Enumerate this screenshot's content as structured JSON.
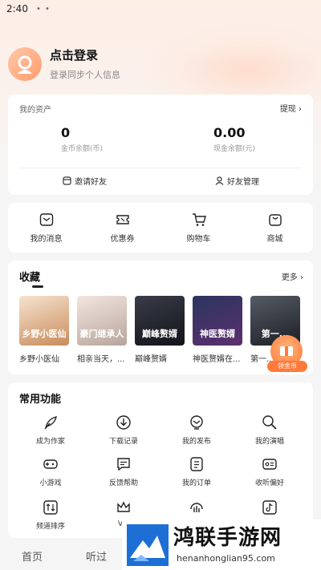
{
  "status": {
    "time": "2:40",
    "dots": "• •"
  },
  "profile": {
    "title": "点击登录",
    "subtitle": "登录同步个人信息"
  },
  "assets": {
    "header": "我的资产",
    "withdraw": "提现 ›",
    "coins_value": "0",
    "coins_label": "金币余额(币)",
    "cash_value": "0.00",
    "cash_label": "现金余额(元)",
    "invite": "邀请好友",
    "friends": "好友管理"
  },
  "quick": [
    {
      "label": "我的消息",
      "icon": "message-icon"
    },
    {
      "label": "优惠券",
      "icon": "coupon-icon"
    },
    {
      "label": "购物车",
      "icon": "cart-icon"
    },
    {
      "label": "商城",
      "icon": "shop-icon"
    }
  ],
  "favorites": {
    "title": "收藏",
    "more": "更多 ›",
    "books": [
      {
        "title": "乡野小医仙",
        "cover_text": "乡野小医仙",
        "colors": [
          "#f6e3cf",
          "#c98c5b"
        ]
      },
      {
        "title": "相亲当天，...",
        "cover_text": "豪门继承人",
        "colors": [
          "#f3e6e0",
          "#b7a59c"
        ]
      },
      {
        "title": "巅峰赘婿",
        "cover_text": "巅峰赘婿",
        "colors": [
          "#3a3d4a",
          "#111318"
        ]
      },
      {
        "title": "神医赘婿在...",
        "cover_text": "神医赘婿",
        "colors": [
          "#2c3560",
          "#5b2f6e"
        ]
      },
      {
        "title": "第一...",
        "cover_text": "第一...",
        "colors": [
          "#555b66",
          "#1c1e24"
        ]
      }
    ],
    "coin_badge": "领金币"
  },
  "tools": {
    "title": "常用功能",
    "items": [
      {
        "label": "成为作家",
        "icon": "feather-icon"
      },
      {
        "label": "下载记录",
        "icon": "download-icon"
      },
      {
        "label": "我的发布",
        "icon": "publish-icon"
      },
      {
        "label": "我的演唱",
        "icon": "sing-icon"
      },
      {
        "label": "小游戏",
        "icon": "gamepad-icon"
      },
      {
        "label": "反馈帮助",
        "icon": "feedback-icon"
      },
      {
        "label": "我的订单",
        "icon": "order-icon"
      },
      {
        "label": "收听偏好",
        "icon": "preference-icon"
      },
      {
        "label": "频道排序",
        "icon": "sort-icon"
      },
      {
        "label": "VIP",
        "icon": "crown-icon"
      },
      {
        "label": "",
        "icon": "chart-icon"
      },
      {
        "label": "",
        "icon": "tiktok-icon"
      }
    ]
  },
  "bottom_nav": {
    "home": "首页",
    "listen": "听过"
  },
  "watermark": {
    "title": "鸿联手游网",
    "url": "henanhonglian95.com"
  },
  "colors": {
    "accent": "#ff7a3a",
    "background": "#f6f5f5"
  }
}
